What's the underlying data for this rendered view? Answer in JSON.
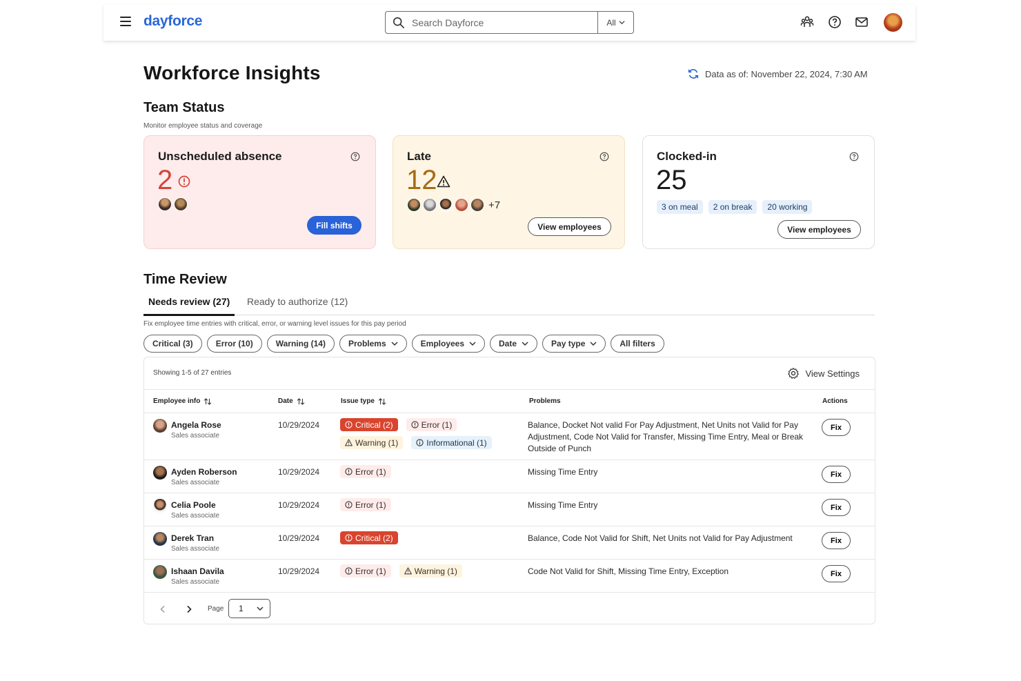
{
  "header": {
    "logo": "dayforce",
    "search_placeholder": "Search Dayforce",
    "search_scope": "All",
    "icons": [
      "menu-icon",
      "team-icon",
      "help-icon",
      "mail-icon",
      "user-avatar"
    ]
  },
  "page": {
    "title": "Workforce Insights",
    "data_as_of": "Data as of: November 22, 2024, 7:30 AM"
  },
  "team_status": {
    "title": "Team Status",
    "subtitle": "Monitor employee status and coverage",
    "cards": [
      {
        "title": "Unscheduled absence",
        "count": "2",
        "icon": "alert-circle-icon",
        "action": "Fill shifts",
        "color": "#d3453a"
      },
      {
        "title": "Late",
        "count": "12",
        "icon": "warning-icon",
        "more": "+7",
        "action": "View employees",
        "color": "#a66b14"
      },
      {
        "title": "Clocked-in",
        "count": "25",
        "chips": [
          "3 on meal",
          "2 on break",
          "20 working"
        ],
        "action": "View employees",
        "color": "#1b1b1b"
      }
    ]
  },
  "time_review": {
    "title": "Time Review",
    "tabs": [
      "Needs review (27)",
      "Ready to authorize (12)"
    ],
    "description": "Fix employee time entries with critical, error, or warning level issues for this pay period",
    "filters": [
      "Critical (3)",
      "Error (10)",
      "Warning (14)",
      "Problems",
      "Employees",
      "Date",
      "Pay type",
      "All filters"
    ],
    "showing": "Showing 1-5 of 27 entries",
    "view_settings": "View Settings",
    "columns": [
      "Employee info",
      "Date",
      "Issue type",
      "Problems",
      "Actions"
    ],
    "rows": [
      {
        "name": "Angela Rose",
        "role": "Sales associate",
        "date": "10/29/2024",
        "issues": [
          [
            "critical",
            "Critical (2)"
          ],
          [
            "error",
            "Error (1)"
          ],
          [
            "warning",
            "Warning (1)"
          ],
          [
            "info",
            "Informational (1)"
          ]
        ],
        "problems": "Balance, Docket Not valid For Pay Adjustment, Net Units not Valid for Pay Adjustment, Code Not Valid for Transfer, Missing Time Entry, Meal or Break Outside of Punch",
        "action": "Fix"
      },
      {
        "name": "Ayden Roberson",
        "role": "Sales associate",
        "date": "10/29/2024",
        "issues": [
          [
            "error",
            "Error (1)"
          ]
        ],
        "problems": "Missing Time Entry",
        "action": "Fix"
      },
      {
        "name": "Celia Poole",
        "role": "Sales associate",
        "date": "10/29/2024",
        "issues": [
          [
            "error",
            "Error (1)"
          ]
        ],
        "problems": "Missing Time Entry",
        "action": "Fix"
      },
      {
        "name": "Derek Tran",
        "role": "Sales associate",
        "date": "10/29/2024",
        "issues": [
          [
            "critical",
            "Critical (2)"
          ]
        ],
        "problems": "Balance, Code Not Valid for Shift, Net Units not Valid for Pay Adjustment",
        "action": "Fix"
      },
      {
        "name": "Ishaan Davila",
        "role": "Sales associate",
        "date": "10/29/2024",
        "issues": [
          [
            "error",
            "Error (1)"
          ],
          [
            "warning",
            "Warning (1)"
          ]
        ],
        "problems": "Code Not Valid for Shift, Missing Time Entry, Exception",
        "action": "Fix"
      }
    ],
    "pager": {
      "label": "Page",
      "current": "1"
    }
  }
}
